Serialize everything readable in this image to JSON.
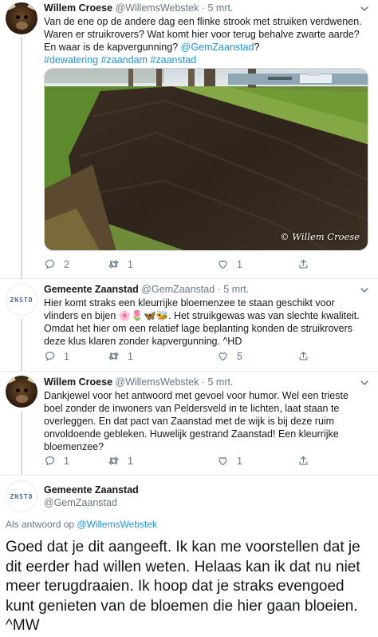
{
  "tweets": [
    {
      "user_name": "Willem Croese",
      "handle_time": "@WillemsWebstek · 5 mrt.",
      "text_1": "Van de ene op de andere dag een flinke strook met struiken verdwenen. Waren er struikrovers? Wat komt hier voor terug behalve zwarte aarde? En waar is de kapvergunning? ",
      "mention": "@GemZaanstad",
      "text_2": "?",
      "hashtags": "#dewatering #zaandam #zaanstad",
      "photo_watermark": "© Willem Croese",
      "photo_alt_icon": "photo-of-cleared-field",
      "reply_count": "2",
      "retweet_count": "1",
      "like_count": "1"
    },
    {
      "user_name": "Gemeente Zaanstad",
      "handle_time": "@GemZaanstad · 5 mrt.",
      "avatar_text": "ZNSTD",
      "text_1": "Hier komt straks een kleurrijke bloemenzee te staan geschikt voor vlinders en bijen ",
      "emojis": "🌸🌷🦋🐝",
      "text_2": ". Het struikgewas was van slechte kwaliteit. Omdat het hier om een relatief lage beplanting konden de struikrovers deze klus klaren zonder kapvergunning. ^HD",
      "reply_count": "1",
      "retweet_count": "1",
      "like_count": "5"
    },
    {
      "user_name": "Willem Croese",
      "handle_time": "@WillemsWebstek · 5 mrt.",
      "text": "Dankjewel voor het antwoord met gevoel voor humor. Wel een trieste boel zonder de inwoners van Peldersveld in te lichten, laat staan te overleggen. En dat pact van Zaanstad met de wijk is bij deze ruim onvoldoende gebleken. Huwelijk gestrand Zaanstad! Een kleurrijke bloemenzee?",
      "reply_count": "1",
      "retweet_count": "1",
      "like_count": "1"
    }
  ],
  "focused": {
    "user_name": "Gemeente Zaanstad",
    "handle": "@GemZaanstad",
    "avatar_text": "ZNSTD",
    "reply_to_prefix": "Als antwoord op ",
    "reply_to_handle": "@WillemsWebstek",
    "text": "Goed dat je dit aangeeft. Ik kan me voorstellen dat je dit eerder had willen weten. Helaas kan ik dat nu niet meer terugdraaien. Ik hoop dat je straks evengoed kunt genieten van de bloemen die hier gaan bloeien.  ^MW"
  },
  "colors": {
    "link": "#1b95e0",
    "muted": "#657786",
    "text": "#14171a",
    "divider": "#e6ecf0"
  },
  "icons": [
    "reply-icon",
    "retweet-icon",
    "like-icon",
    "share-icon",
    "chevron-down-icon"
  ]
}
